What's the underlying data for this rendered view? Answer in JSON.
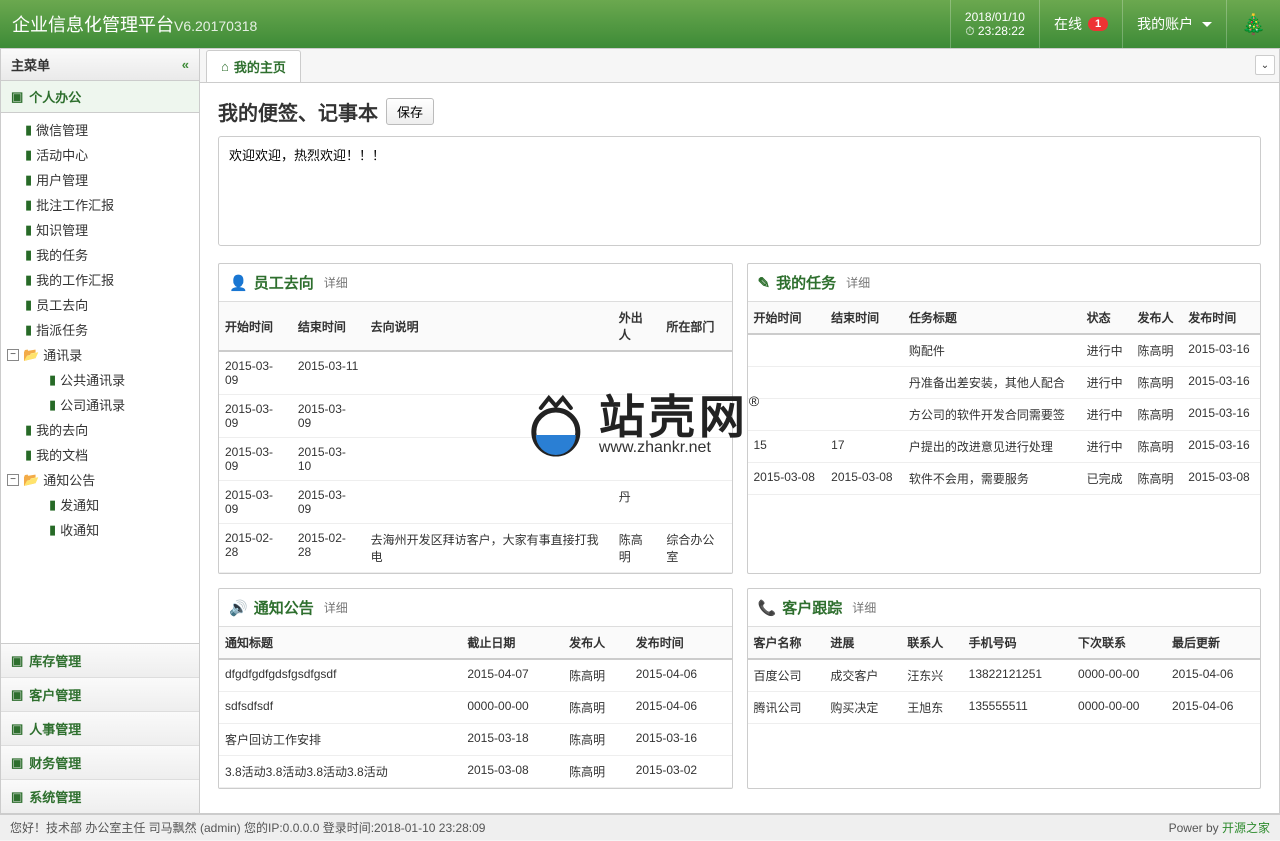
{
  "header": {
    "title_main": "企业信息化管理平台",
    "title_ver": "V6.20170318",
    "date": "2018/01/10",
    "time": "23:28:22",
    "online_label": "在线",
    "online_count": "1",
    "account_label": "我的账户"
  },
  "sidebar": {
    "main_menu_title": "主菜单",
    "section": "个人办公",
    "tree": [
      {
        "label": "微信管理"
      },
      {
        "label": "活动中心"
      },
      {
        "label": "用户管理"
      },
      {
        "label": "批注工作汇报"
      },
      {
        "label": "知识管理"
      },
      {
        "label": "我的任务"
      },
      {
        "label": "我的工作汇报"
      },
      {
        "label": "员工去向"
      },
      {
        "label": "指派任务"
      },
      {
        "label": "通讯录",
        "folder": true,
        "open": true,
        "children": [
          {
            "label": "公共通讯录"
          },
          {
            "label": "公司通讯录"
          }
        ]
      },
      {
        "label": "我的去向"
      },
      {
        "label": "我的文档"
      },
      {
        "label": "通知公告",
        "folder": true,
        "open": true,
        "children": [
          {
            "label": "发通知"
          },
          {
            "label": "收通知"
          }
        ]
      }
    ],
    "bottom": [
      "库存管理",
      "客户管理",
      "人事管理",
      "财务管理",
      "系统管理"
    ]
  },
  "tabs": {
    "home": "我的主页"
  },
  "notes": {
    "title": "我的便签、记事本",
    "save": "保存",
    "content": "欢迎欢迎，热烈欢迎！！！"
  },
  "detail_label": "详细",
  "panel_staff": {
    "title": "员工去向",
    "headers": [
      "开始时间",
      "结束时间",
      "去向说明",
      "外出人",
      "所在部门"
    ],
    "rows": [
      [
        "2015-03-09",
        "2015-03-11",
        "",
        "",
        ""
      ],
      [
        "2015-03-09",
        "2015-03-09",
        "",
        "",
        ""
      ],
      [
        "2015-03-09",
        "2015-03-10",
        "",
        "",
        ""
      ],
      [
        "2015-03-09",
        "2015-03-09",
        "",
        "丹",
        ""
      ],
      [
        "2015-02-28",
        "2015-02-28",
        "去海州开发区拜访客户，大家有事直接打我电",
        "陈高明",
        "综合办公室"
      ]
    ]
  },
  "panel_tasks": {
    "title": "我的任务",
    "headers": [
      "开始时间",
      "结束时间",
      "任务标题",
      "状态",
      "发布人",
      "发布时间"
    ],
    "rows": [
      [
        "",
        "",
        "购配件",
        "进行中",
        "陈高明",
        "2015-03-16"
      ],
      [
        "",
        "",
        "丹准备出差安装，其他人配合",
        "进行中",
        "陈高明",
        "2015-03-16"
      ],
      [
        "",
        "",
        "方公司的软件开发合同需要签",
        "进行中",
        "陈高明",
        "2015-03-16"
      ],
      [
        "15",
        "17",
        "户提出的改进意见进行处理",
        "进行中",
        "陈高明",
        "2015-03-16"
      ],
      [
        "2015-03-08",
        "2015-03-08",
        "软件不会用，需要服务",
        "已完成",
        "陈高明",
        "2015-03-08"
      ]
    ]
  },
  "panel_notice": {
    "title": "通知公告",
    "headers": [
      "通知标题",
      "截止日期",
      "发布人",
      "发布时间"
    ],
    "rows": [
      [
        "dfgdfgdfgdsfgsdfgsdf",
        "2015-04-07",
        "陈高明",
        "2015-04-06"
      ],
      [
        "sdfsdfsdf",
        "0000-00-00",
        "陈高明",
        "2015-04-06"
      ],
      [
        "客户回访工作安排",
        "2015-03-18",
        "陈高明",
        "2015-03-16"
      ],
      [
        "3.8活动3.8活动3.8活动3.8活动",
        "2015-03-08",
        "陈高明",
        "2015-03-02"
      ]
    ]
  },
  "panel_customer": {
    "title": "客户跟踪",
    "headers": [
      "客户名称",
      "进展",
      "联系人",
      "手机号码",
      "下次联系",
      "最后更新"
    ],
    "rows": [
      [
        "百度公司",
        "成交客户",
        "汪东兴",
        "13822121251",
        "0000-00-00",
        "2015-04-06"
      ],
      [
        "腾讯公司",
        "购买决定",
        "王旭东",
        "135555511",
        "0000-00-00",
        "2015-04-06"
      ]
    ]
  },
  "footer": {
    "left": "您好！技术部 办公室主任 司马飘然 (admin) 您的IP:0.0.0.0 登录时间:2018-01-10 23:28:09",
    "power": "Power by ",
    "link": "开源之家"
  },
  "watermark": {
    "big": "站壳网",
    "url": "www.zhankr.net",
    "reg": "®"
  }
}
